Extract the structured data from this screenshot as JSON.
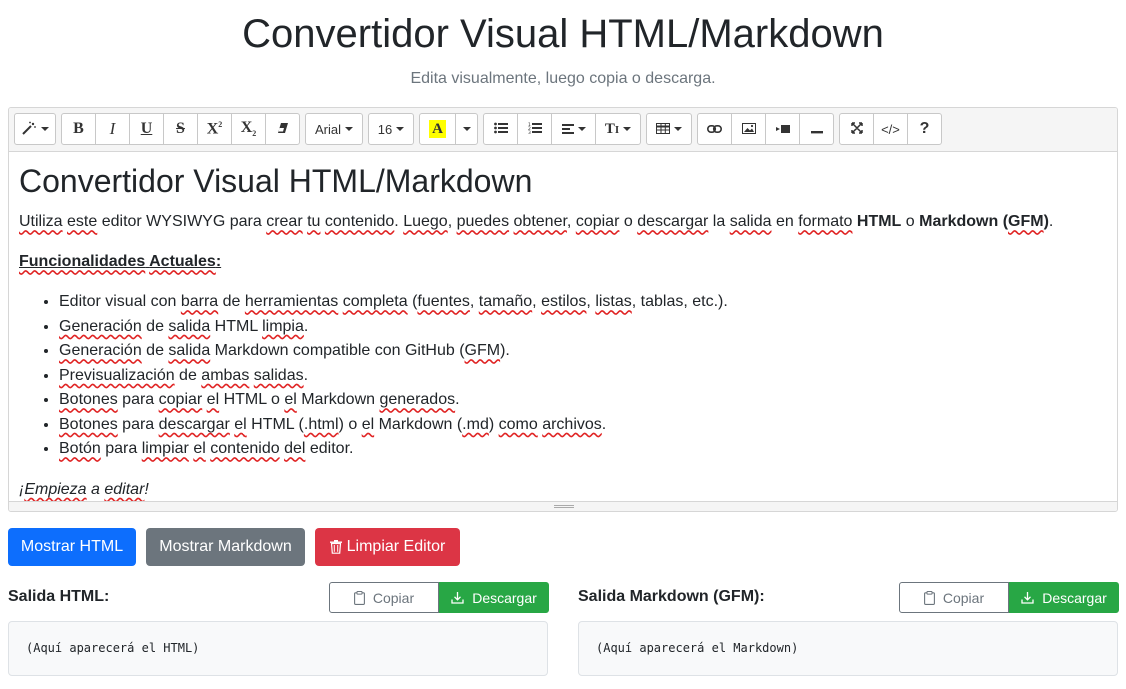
{
  "header": {
    "title": "Convertidor Visual HTML/Markdown",
    "subtitle": "Edita visualmente, luego copia o descarga."
  },
  "toolbar": {
    "font_name": "Arial",
    "font_size": "16",
    "icons": [
      "magic-icon",
      "bold-icon",
      "italic-icon",
      "underline-icon",
      "strikethrough-icon",
      "superscript-icon",
      "subscript-icon",
      "eraser-icon",
      "font-color-icon",
      "unordered-list-icon",
      "ordered-list-icon",
      "align-icon",
      "line-height-icon",
      "table-icon",
      "link-icon",
      "picture-icon",
      "video-icon",
      "horizontal-rule-icon",
      "fullscreen-icon",
      "code-view-icon",
      "help-icon"
    ]
  },
  "editor": {
    "heading": "Convertidor Visual HTML/Markdown",
    "intro": {
      "w1": "Utiliza",
      "w2": "este",
      "t1": " editor WYSIWYG para ",
      "w3": "crear",
      "t2": " ",
      "w4": "tu",
      "t3": " ",
      "w5": "contenido",
      "t4": ". ",
      "w6": "Luego",
      "t5": ", ",
      "w7": "puedes",
      "t6": " ",
      "w8": "obtener",
      "t7": ", ",
      "w9": "copiar",
      "t8": " o ",
      "w10": "descargar",
      "t9": " la ",
      "w11": "salida",
      "t10": " en ",
      "w12": "formato",
      "t11": " ",
      "b1": "HTML",
      "t12": " o ",
      "b2": "Markdown (",
      "w13": "GFM",
      "b3": ")",
      "t13": "."
    },
    "features_heading": {
      "w1": "Funcionalidades",
      "t1": " ",
      "w2": "Actuales",
      "t2": ":"
    },
    "features": [
      {
        "t1": "Editor visual con ",
        "w1": "barra",
        "t2": " de ",
        "w2": "herramientas",
        "t3": " ",
        "w3": "completa",
        "t4": " (",
        "w4": "fuentes",
        "t5": ", ",
        "w5": "tamaño",
        "t6": ", ",
        "w6": "estilos",
        "t7": ", ",
        "w7": "listas",
        "t8": ", tablas, etc.)."
      },
      {
        "w1": "Generación",
        "t1": " de ",
        "w2": "salida",
        "t2": " HTML ",
        "w3": "limpia",
        "t3": "."
      },
      {
        "w1": "Generación",
        "t1": " de ",
        "w2": "salida",
        "t2": " Markdown compatible con GitHub (",
        "w3": "GFM",
        "t3": ")."
      },
      {
        "w1": "Previsualización",
        "t1": " de ",
        "w2": "ambas",
        "t2": " ",
        "w3": "salidas",
        "t3": "."
      },
      {
        "w1": "Botones",
        "t1": " para ",
        "w2": "copiar",
        "t2": " ",
        "w3": "el",
        "t3": " HTML o ",
        "w4": "el",
        "t4": " Markdown ",
        "w5": "generados",
        "t5": "."
      },
      {
        "w1": "Botones",
        "t1": " para ",
        "w2": "descargar",
        "t2": " ",
        "w3": "el",
        "t3": " HTML (",
        "w4": ".html",
        "t4": ") o ",
        "w5": "el",
        "t5": " Markdown (",
        "w6": ".md",
        "t6": ") ",
        "w7": "como",
        "t7": " ",
        "w8": "archivos",
        "t8": "."
      },
      {
        "w1": "Botón",
        "t1": " para ",
        "w2": "limpiar",
        "t2": " ",
        "w3": "el",
        "t3": " ",
        "w4": "contenido",
        "t4": " ",
        "w5": "del",
        "t5": " editor."
      }
    ],
    "closing": {
      "t1": "¡",
      "w1": "Empieza",
      "t2": " a ",
      "w2": "editar",
      "t3": "!"
    }
  },
  "actions": {
    "show_html": "Mostrar HTML",
    "show_markdown": "Mostrar Markdown",
    "clear_editor": "Limpiar Editor"
  },
  "output_html": {
    "label": "Salida HTML:",
    "copy": "Copiar",
    "download": "Descargar",
    "placeholder": "(Aquí aparecerá el HTML)"
  },
  "output_markdown": {
    "label": "Salida Markdown (GFM):",
    "copy": "Copiar",
    "download": "Descargar",
    "placeholder": "(Aquí aparecerá el Markdown)"
  },
  "colors": {
    "primary": "#0d6efd",
    "secondary": "#6c757d",
    "danger": "#dc3545",
    "success": "#28a745",
    "highlight": "#ffff00",
    "spellcheck": "#e02424"
  }
}
